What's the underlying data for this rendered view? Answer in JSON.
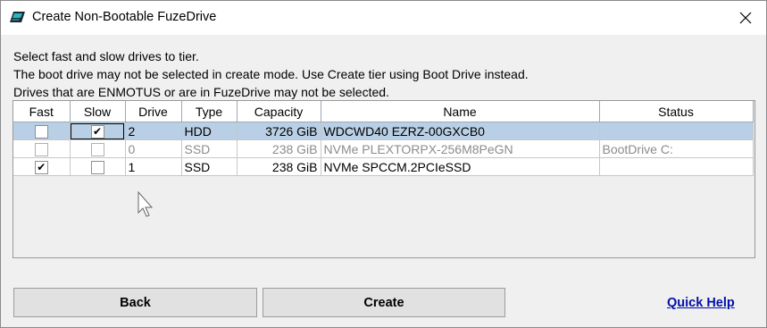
{
  "window": {
    "title": "Create Non-Bootable FuzeDrive",
    "icons": {
      "app": "fuzedrive-app-icon",
      "close": "close-icon"
    }
  },
  "instructions": [
    "Select fast and slow drives to tier.",
    "The boot drive may not be selected in create mode. Use Create tier using Boot Drive instead.",
    "Drives that are ENMOTUS or are in FuzeDrive may not be selected."
  ],
  "table": {
    "columns": [
      "Fast",
      "Slow",
      "Drive",
      "Type",
      "Capacity",
      "Name",
      "Status"
    ],
    "rows": [
      {
        "fast": false,
        "slow": true,
        "drive": "2",
        "type": "HDD",
        "capacity": "3726 GiB",
        "name": "WDCWD40 EZRZ-00GXCB0",
        "status": "",
        "selected": true,
        "disabled": false
      },
      {
        "fast": false,
        "slow": false,
        "drive": "0",
        "type": "SSD",
        "capacity": "238 GiB",
        "name": "NVMe PLEXTORPX-256M8PeGN",
        "status": "BootDrive C:",
        "selected": false,
        "disabled": true
      },
      {
        "fast": true,
        "slow": false,
        "drive": "1",
        "type": "SSD",
        "capacity": "238 GiB",
        "name": "NVMe SPCCM.2PCIeSSD",
        "status": "",
        "selected": false,
        "disabled": false
      }
    ],
    "check_glyph": "✔"
  },
  "buttons": {
    "back": "Back",
    "create": "Create",
    "quick_help": "Quick Help"
  },
  "colors": {
    "selected_row": "#b8cfe5",
    "link": "#000fa8",
    "button_face": "#e1e1e1",
    "window_bg": "#f0f0f0"
  }
}
